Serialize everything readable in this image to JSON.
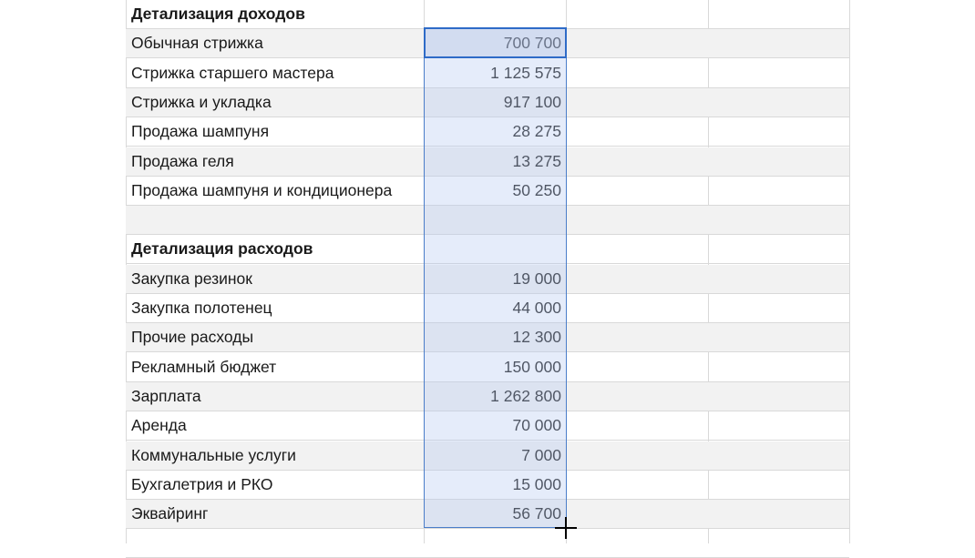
{
  "rows": [
    {
      "label": "Детализация доходов",
      "value": "",
      "bold": true
    },
    {
      "label": "Обычная стрижка",
      "value": "700 700"
    },
    {
      "label": "Стрижка старшего мастера",
      "value": "1 125 575"
    },
    {
      "label": "Стрижка и укладка",
      "value": "917 100"
    },
    {
      "label": "Продажа шампуня",
      "value": "28 275"
    },
    {
      "label": "Продажа геля",
      "value": "13 275"
    },
    {
      "label": "Продажа шампуня и кондиционера",
      "value": "50 250"
    },
    {
      "label": "",
      "value": ""
    },
    {
      "label": "Детализация расходов",
      "value": "",
      "bold": true
    },
    {
      "label": "Закупка резинок",
      "value": "19 000"
    },
    {
      "label": "Закупка полотенец",
      "value": "44 000"
    },
    {
      "label": "Прочие расходы",
      "value": "12 300"
    },
    {
      "label": "Рекламный бюджет",
      "value": "150 000"
    },
    {
      "label": "Зарплата",
      "value": "1 262 800"
    },
    {
      "label": "Аренда",
      "value": "70 000"
    },
    {
      "label": "Коммунальные услуги",
      "value": "7 000"
    },
    {
      "label": "Бухгалетрия и РКО",
      "value": "15 000"
    },
    {
      "label": "Эквайринг",
      "value": "56 700"
    },
    {
      "label": "",
      "value": ""
    }
  ],
  "colors": {
    "selection_border": "#2e6bc7",
    "row_shade": "#f2f2f2",
    "grid": "#d9d9d9"
  }
}
